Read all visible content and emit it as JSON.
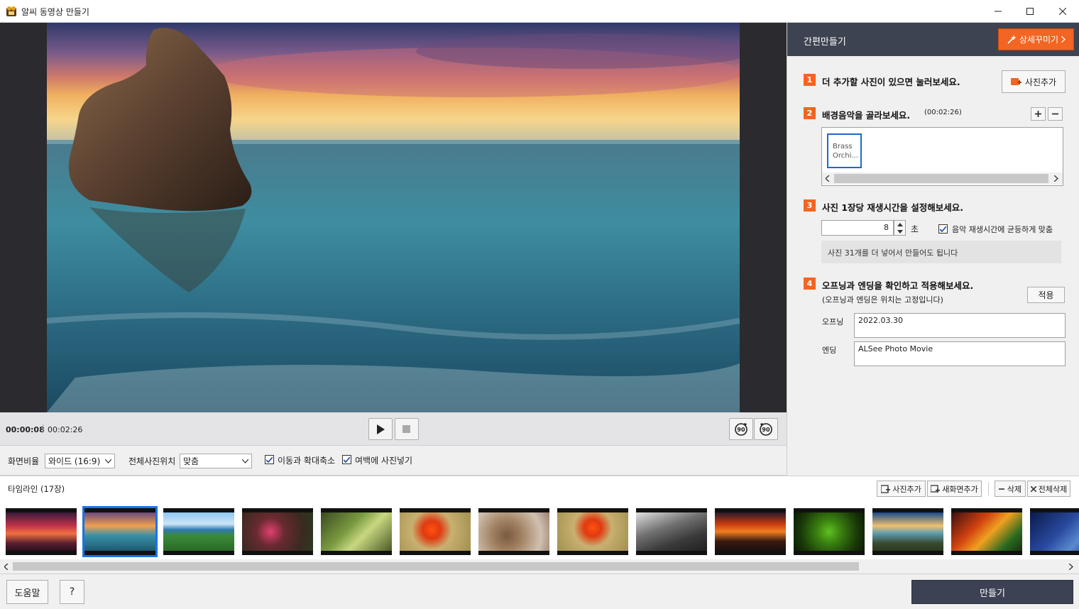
{
  "window": {
    "title": "알씨 동영상 만들기"
  },
  "player": {
    "current_time": "00:00:08",
    "total_time": "00:02:26",
    "rotate_right": "90",
    "rotate_left": "90"
  },
  "options": {
    "ratio_label": "화면비율",
    "ratio_value": "와이드 (16:9)",
    "position_label": "전체사진위치",
    "position_value": "맞춤",
    "move_zoom_label": "이동과 확대축소",
    "fill_margin_label": "여백에 사진넣기"
  },
  "panel": {
    "title": "간편만들기",
    "detail_button": "상세꾸미기",
    "step1": {
      "num": "1",
      "text": "더 추가할 사진이 있으면 눌러보세요.",
      "button": "사진추가"
    },
    "step2": {
      "num": "2",
      "text": "배경음악을 골라보세요.",
      "duration": "(00:02:26)",
      "music_item_line1": "Brass",
      "music_item_line2": "Orchi..."
    },
    "step3": {
      "num": "3",
      "text": "사진 1장당 재생시간을 설정해보세요.",
      "seconds_value": "8",
      "seconds_unit": "초",
      "fit_label": "음악 재생시간에 균등하게 맞춤",
      "info": "사진 31개를 더 넣어서 만들어도 됩니다"
    },
    "step4": {
      "num": "4",
      "text": "오프닝과 엔딩을 확인하고 적용해보세요.",
      "subtext": "(오프닝과 엔딩은 위치는 고정입니다)",
      "apply_button": "적용",
      "opening_label": "오프닝",
      "opening_value": "2022.03.30",
      "ending_label": "엔딩",
      "ending_value": "ALSee Photo Movie"
    }
  },
  "timeline": {
    "title": "타임라인 (17장)",
    "add_photo": "사진추가",
    "add_screen": "새화면추가",
    "delete": "삭제",
    "delete_all": "전체삭제",
    "thumbnails": [
      {
        "bg": "linear-gradient(180deg,#3a1a3a 0%,#c2334a 35%,#f07040 55%,#5a2030 80%,#2a1020 100%)"
      },
      {
        "bg": "linear-gradient(180deg,#6a4a7a 0%,#f0a050 35%,#3a90a8 60%,#1d5a70 100%)"
      },
      {
        "bg": "linear-gradient(180deg,#8fc8f0 0%,#cde6f7 30%,#2e7ab0 45%,#3b8a3a 60%,#2a6a25 100%)"
      },
      {
        "bg": "radial-gradient(circle at 40% 50%,#e04070 0%,#6a2a30 30%,#3a2a20 70%,#2a3a20 100%)"
      },
      {
        "bg": "linear-gradient(135deg,#3a4a20 0%,#7a9a40 40%,#c8d880 60%,#4a5a25 100%)"
      },
      {
        "bg": "radial-gradient(circle at 45% 45%,#ff5010 0%,#e03a10 20%,#c8b070 45%,#a09050 100%)"
      },
      {
        "bg": "radial-gradient(circle at 40% 60%,#7a5a40 0%,#a08060 30%,#d0c0b0 70%,#9a8070 100%)"
      },
      {
        "bg": "radial-gradient(circle at 50% 40%,#ff5010 0%,#e03a10 20%,#c8b070 45%,#a09050 100%)"
      },
      {
        "bg": "linear-gradient(160deg,#e0e0e0 0%,#707070 40%,#3a3a3a 70%,#202020 100%)"
      },
      {
        "bg": "linear-gradient(180deg,#2a1a2a 0%,#c83a10 30%,#f08020 50%,#3a1a10 75%,#1a1010 100%)"
      },
      {
        "bg": "radial-gradient(circle at 50% 50%,#60c020 0%,#3a8010 30%,#1a3a08 70%,#0a1a04 100%)"
      },
      {
        "bg": "linear-gradient(180deg,#1a4a8a 0%,#f0c070 35%,#5a9ab0 55%,#3a4a30 80%,#2a3a20 100%)"
      },
      {
        "bg": "linear-gradient(135deg,#3a1010 0%,#d04010 35%,#f0a020 55%,#2a6a20 80%,#1a3010 100%)"
      },
      {
        "bg": "linear-gradient(135deg,#0a1a4a 0%,#2a4aa0 45%,#5a8ad0 70%,#1a2a5a 100%)"
      }
    ]
  },
  "footer": {
    "help": "도움말",
    "question": "?",
    "make": "만들기"
  }
}
